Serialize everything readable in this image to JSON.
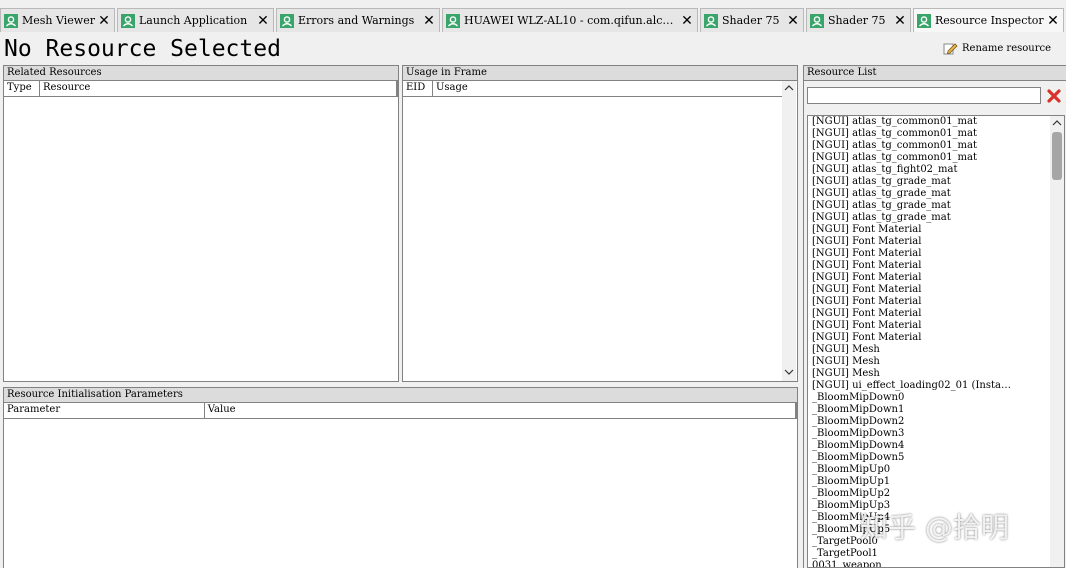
{
  "tabs": [
    {
      "label": "Mesh Viewer",
      "close": "✕"
    },
    {
      "label": "Launch Application",
      "close": "✕"
    },
    {
      "label": "Errors and Warnings",
      "close": "✕"
    },
    {
      "label": "HUAWEI WLZ-AL10 - com.qifun.alche…",
      "close": "✕"
    },
    {
      "label": "Shader 75",
      "close": "✕"
    },
    {
      "label": "Shader 75",
      "close": "✕"
    },
    {
      "label": "Resource Inspector",
      "close": "✕"
    }
  ],
  "header": {
    "title": "No Resource Selected",
    "rename_label": "Rename resource"
  },
  "related": {
    "title": "Related Resources",
    "columns": [
      "Type",
      "Resource"
    ]
  },
  "usage": {
    "title": "Usage in Frame",
    "columns": [
      "EID",
      "Usage"
    ]
  },
  "init_params": {
    "title": "Resource Initialisation Parameters",
    "columns": [
      "Parameter",
      "Value"
    ]
  },
  "resource_list": {
    "title": "Resource List",
    "search_value": "",
    "items": [
      "[NGUI] atlas_tg_common01_mat",
      "[NGUI] atlas_tg_common01_mat",
      "[NGUI] atlas_tg_common01_mat",
      "[NGUI] atlas_tg_common01_mat",
      "[NGUI] atlas_tg_fight02_mat",
      "[NGUI] atlas_tg_grade_mat",
      "[NGUI] atlas_tg_grade_mat",
      "[NGUI] atlas_tg_grade_mat",
      "[NGUI] atlas_tg_grade_mat",
      "[NGUI] Font Material",
      "[NGUI] Font Material",
      "[NGUI] Font Material",
      "[NGUI] Font Material",
      "[NGUI] Font Material",
      "[NGUI] Font Material",
      "[NGUI] Font Material",
      "[NGUI] Font Material",
      "[NGUI] Font Material",
      "[NGUI] Font Material",
      "[NGUI] Mesh",
      "[NGUI] Mesh",
      "[NGUI] Mesh",
      "[NGUI] ui_effect_loading02_01 (Insta…",
      "_BloomMipDown0",
      "_BloomMipDown1",
      "_BloomMipDown2",
      "_BloomMipDown3",
      "_BloomMipDown4",
      "_BloomMipDown5",
      "_BloomMipUp0",
      "_BloomMipUp1",
      "_BloomMipUp2",
      "_BloomMipUp3",
      "_BloomMipUp4",
      "_BloomMipUp5",
      "_TargetPool0",
      "_TargetPool1",
      "0031_weapon"
    ]
  },
  "watermark": "知乎 @拾明",
  "colors": {
    "tab_icon": "#3aa56a",
    "clear_icon": "#d9322a",
    "panel_title_bg": "#dcdcdc"
  },
  "icons": {
    "tab": "user-icon",
    "rename": "pencil-icon",
    "clear": "red-x-icon"
  }
}
